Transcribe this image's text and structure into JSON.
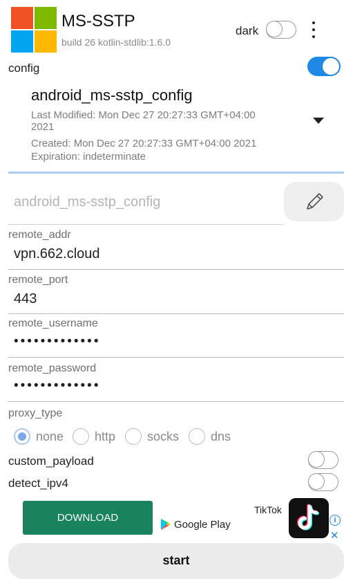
{
  "header": {
    "app_name": "MS-SSTP",
    "build_info": "build 26 kotlin-stdlib:1.6.0",
    "dark_label": "dark",
    "dark_enabled": false,
    "logo_colors": [
      "#f05323",
      "#7fba00",
      "#00a4ef",
      "#ffb900"
    ]
  },
  "config": {
    "label": "config",
    "enabled": true,
    "selected_profile": {
      "name": "android_ms-sstp_config",
      "last_modified_line1": "Last Modified: Mon Dec 27 20:27:33 GMT+04:00",
      "last_modified_line2": "2021",
      "created": "Created: Mon Dec 27 20:27:33 GMT+04:00 2021",
      "expiration": "Expiration: indeterminate"
    },
    "profile_name_field": "android_ms-sstp_config"
  },
  "fields": {
    "remote_addr": {
      "label": "remote_addr",
      "value": "vpn.662.cloud"
    },
    "remote_port": {
      "label": "remote_port",
      "value": "443"
    },
    "remote_username": {
      "label": "remote_username",
      "value": "•••••••••••••"
    },
    "remote_password": {
      "label": "remote_password",
      "value": "•••••••••••••"
    }
  },
  "proxy": {
    "label": "proxy_type",
    "options": [
      "none",
      "http",
      "socks",
      "dns"
    ],
    "selected": "none"
  },
  "toggles": {
    "custom_payload": {
      "label": "custom_payload",
      "enabled": false
    },
    "detect_ipv4": {
      "label": "detect_ipv4",
      "enabled": false
    }
  },
  "ad": {
    "download_label": "DOWNLOAD",
    "store_label": "Google Play",
    "brand": "TikTok",
    "info_icon": "info-icon",
    "close_icon": "close-icon"
  },
  "actions": {
    "start_label": "start"
  },
  "colors": {
    "accent": "#1e88e5",
    "ad_button": "#18835d"
  }
}
